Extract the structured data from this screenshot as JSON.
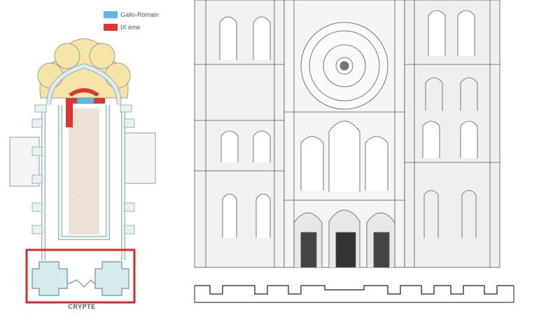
{
  "legend": {
    "items": [
      {
        "label": "Gallo-Romain",
        "color": "#5db8e8"
      },
      {
        "label": "IX ème",
        "color": "#d93636"
      }
    ]
  },
  "plan": {
    "crypt_label": "CRYPTE",
    "highlight_color": "#d92b2b"
  }
}
